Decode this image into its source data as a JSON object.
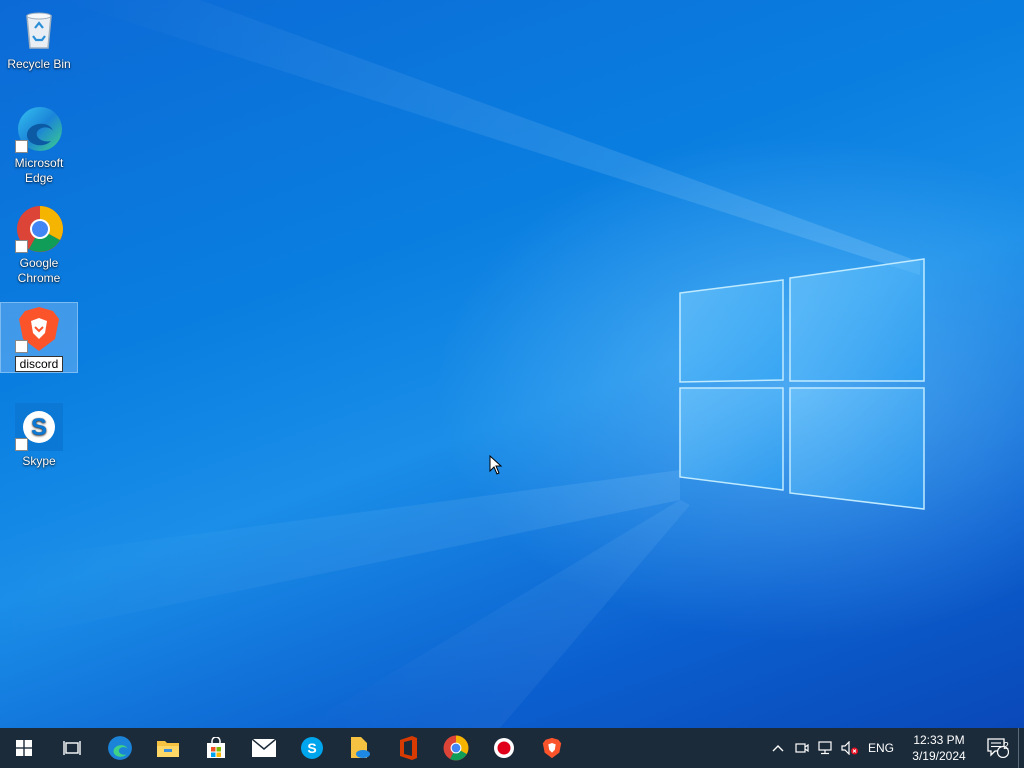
{
  "desktop": {
    "icons": [
      {
        "label": "Recycle Bin"
      },
      {
        "label": "Microsoft Edge"
      },
      {
        "label": "Google Chrome"
      },
      {
        "label": "discord"
      },
      {
        "label": "Skype"
      }
    ]
  },
  "taskbar": {
    "apps": [
      "start",
      "task-view",
      "edge",
      "file-explorer",
      "store",
      "mail",
      "skype",
      "files",
      "office",
      "chrome",
      "recorder",
      "brave"
    ],
    "tray": {
      "language": "ENG",
      "time": "12:33 PM",
      "date": "3/19/2024",
      "notification_count": "2"
    }
  },
  "colors": {
    "taskbar_bg": "#1c2b3a",
    "desktop_blue": "#0a7ee0"
  }
}
